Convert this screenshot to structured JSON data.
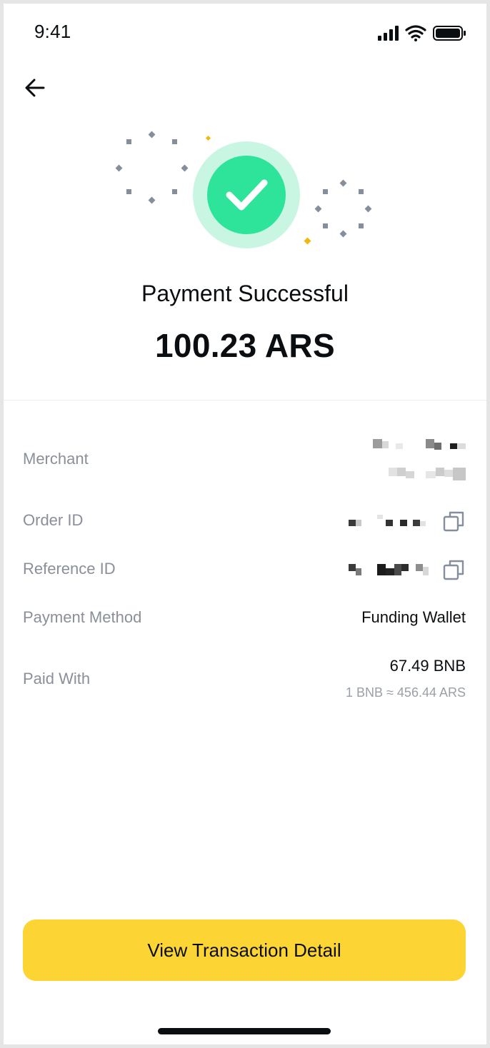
{
  "status_bar": {
    "time": "9:41",
    "icons": [
      "cellular-signal-icon",
      "wifi-icon",
      "battery-icon"
    ]
  },
  "nav": {
    "back_icon": "arrow-left-icon"
  },
  "result": {
    "title": "Payment Successful",
    "amount": "100.23 ARS",
    "icon": "checkmark-circle-icon"
  },
  "details": {
    "merchant_label": "Merchant",
    "order_id_label": "Order ID",
    "reference_id_label": "Reference ID",
    "payment_method_label": "Payment Method",
    "payment_method_value": "Funding Wallet",
    "paid_with_label": "Paid With",
    "paid_with_value": "67.49 BNB",
    "rate": "1 BNB ≈ 456.44 ARS",
    "copy_icon": "copy-icon"
  },
  "actions": {
    "view_detail_label": "View Transaction Detail"
  },
  "colors": {
    "accent": "#FCD535",
    "success": "#2EE39A",
    "success_halo": "#C9F6E2",
    "text_primary": "#0B0E11",
    "text_secondary": "#8A8F99"
  }
}
